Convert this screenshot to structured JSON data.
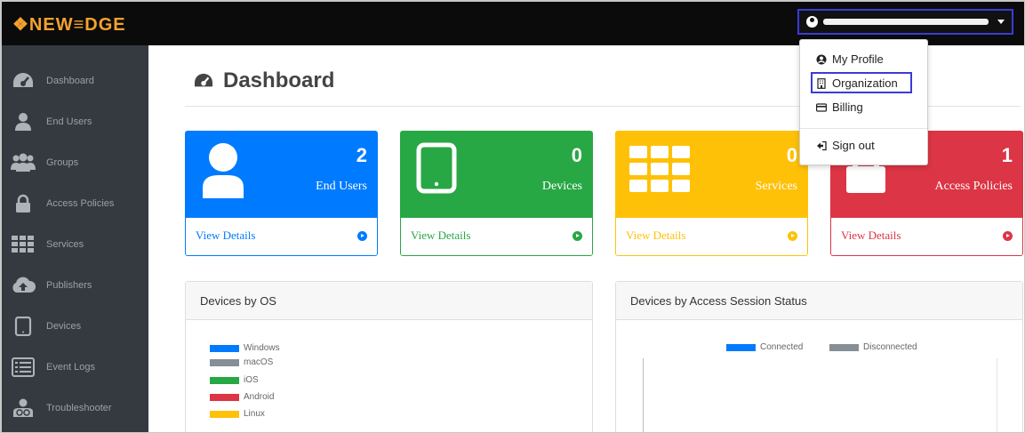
{
  "app": {
    "logo": "❖NEW≡DGE"
  },
  "header": {
    "user_menu": {
      "redacted": true
    }
  },
  "sidebar": {
    "items": [
      {
        "label": "Dashboard",
        "icon": "dashboard-icon"
      },
      {
        "label": "End Users",
        "icon": "user-icon"
      },
      {
        "label": "Groups",
        "icon": "users-icon"
      },
      {
        "label": "Access Policies",
        "icon": "lock-icon"
      },
      {
        "label": "Services",
        "icon": "grid-icon"
      },
      {
        "label": "Publishers",
        "icon": "cloud-upload-icon"
      },
      {
        "label": "Devices",
        "icon": "tablet-icon"
      },
      {
        "label": "Event Logs",
        "icon": "list-icon"
      },
      {
        "label": "Troubleshooter",
        "icon": "user-support-icon"
      }
    ]
  },
  "main": {
    "title": "Dashboard",
    "cards": [
      {
        "count": "2",
        "label": "End Users",
        "link": "View Details",
        "color": "#007bff",
        "icon": "user-icon"
      },
      {
        "count": "0",
        "label": "Devices",
        "link": "View Details",
        "color": "#28a745",
        "icon": "tablet-icon"
      },
      {
        "count": "0",
        "label": "Services",
        "link": "View Details",
        "color": "#ffc107",
        "icon": "grid-icon"
      },
      {
        "count": "1",
        "label": "Access Policies",
        "link": "View Details",
        "color": "#dc3545",
        "icon": "lock-icon"
      }
    ],
    "panels": [
      {
        "title": "Devices by OS",
        "legend": [
          {
            "label": "Windows",
            "color": "#007bff"
          },
          {
            "label": "macOS",
            "color": "#868e96"
          },
          {
            "label": "iOS",
            "color": "#28a745"
          },
          {
            "label": "Android",
            "color": "#dc3545"
          },
          {
            "label": "Linux",
            "color": "#ffc107"
          }
        ]
      },
      {
        "title": "Devices by Access Session Status",
        "legend": [
          {
            "label": "Connected",
            "color": "#007bff"
          },
          {
            "label": "Disconnected",
            "color": "#868e96"
          }
        ]
      }
    ]
  },
  "dropdown": {
    "items": [
      {
        "label": "My Profile",
        "icon": "user-circle-icon"
      },
      {
        "label": "Organization",
        "icon": "building-icon"
      },
      {
        "label": "Billing",
        "icon": "credit-card-icon"
      },
      {
        "label": "Sign out",
        "icon": "sign-out-icon"
      }
    ]
  }
}
